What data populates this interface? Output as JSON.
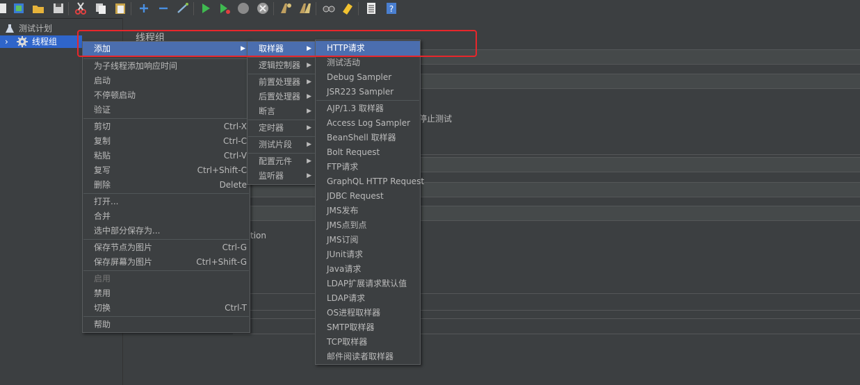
{
  "tree": {
    "items": [
      {
        "label": "测试计划",
        "icon": "flask-icon"
      },
      {
        "label": "线程组",
        "icon": "gear-icon"
      }
    ]
  },
  "panel": {
    "title": "线程组",
    "fragment_stop": "停止测试",
    "fragment_tion": "tion"
  },
  "context_menu": {
    "items": [
      {
        "label": "添加",
        "shortcut": ""
      },
      {
        "label": "为子线程添加响应时间",
        "shortcut": ""
      },
      {
        "label": "启动",
        "shortcut": ""
      },
      {
        "label": "不停顿启动",
        "shortcut": ""
      },
      {
        "label": "验证",
        "shortcut": ""
      },
      {
        "label": "剪切",
        "shortcut": "Ctrl-X"
      },
      {
        "label": "复制",
        "shortcut": "Ctrl-C"
      },
      {
        "label": "粘贴",
        "shortcut": "Ctrl-V"
      },
      {
        "label": "复写",
        "shortcut": "Ctrl+Shift-C"
      },
      {
        "label": "删除",
        "shortcut": "Delete"
      },
      {
        "label": "打开...",
        "shortcut": ""
      },
      {
        "label": "合并",
        "shortcut": ""
      },
      {
        "label": "选中部分保存为...",
        "shortcut": ""
      },
      {
        "label": "保存节点为图片",
        "shortcut": "Ctrl-G"
      },
      {
        "label": "保存屏幕为图片",
        "shortcut": "Ctrl+Shift-G"
      },
      {
        "label": "启用",
        "shortcut": ""
      },
      {
        "label": "禁用",
        "shortcut": ""
      },
      {
        "label": "切换",
        "shortcut": "Ctrl-T"
      },
      {
        "label": "帮助",
        "shortcut": ""
      }
    ]
  },
  "add_submenu": {
    "items": [
      {
        "label": "取样器"
      },
      {
        "label": "逻辑控制器"
      },
      {
        "label": "前置处理器"
      },
      {
        "label": "后置处理器"
      },
      {
        "label": "断言"
      },
      {
        "label": "定时器"
      },
      {
        "label": "测试片段"
      },
      {
        "label": "配置元件"
      },
      {
        "label": "监听器"
      }
    ]
  },
  "sampler_submenu": {
    "items": [
      {
        "label": "HTTP请求"
      },
      {
        "label": "测试活动"
      },
      {
        "label": "Debug Sampler"
      },
      {
        "label": "JSR223 Sampler"
      },
      {
        "label": "AJP/1.3 取样器"
      },
      {
        "label": "Access Log Sampler"
      },
      {
        "label": "BeanShell 取样器"
      },
      {
        "label": "Bolt Request"
      },
      {
        "label": "FTP请求"
      },
      {
        "label": "GraphQL HTTP Request"
      },
      {
        "label": "JDBC Request"
      },
      {
        "label": "JMS发布"
      },
      {
        "label": "JMS点到点"
      },
      {
        "label": "JMS订阅"
      },
      {
        "label": "JUnit请求"
      },
      {
        "label": "Java请求"
      },
      {
        "label": "LDAP扩展请求默认值"
      },
      {
        "label": "LDAP请求"
      },
      {
        "label": "OS进程取样器"
      },
      {
        "label": "SMTP取样器"
      },
      {
        "label": "TCP取样器"
      },
      {
        "label": "邮件阅读者取样器"
      }
    ]
  },
  "colors": {
    "background": "#3c3f41",
    "selection": "#4b6eaf",
    "highlight_box": "#e8262b"
  }
}
